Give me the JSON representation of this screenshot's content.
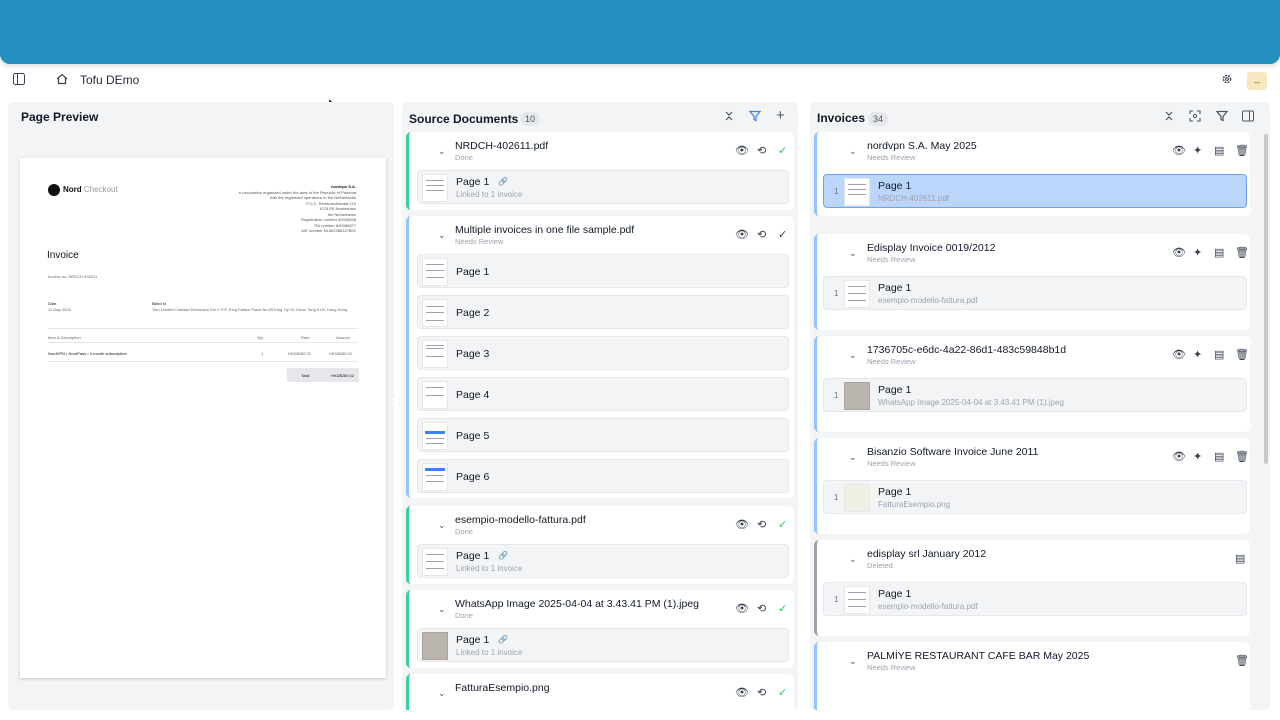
{
  "app": {
    "title": "Tofu DEmo",
    "avatar_text": "_"
  },
  "icons": {
    "sidebar_toggle": "sidebar-toggle-icon",
    "home": "home-icon",
    "settings": "gear-icon",
    "collapse": "collapse-icon",
    "filter": "filter-icon",
    "add": "plus-icon",
    "focus": "focus-icon",
    "split": "split-view-icon",
    "view": "eye-icon",
    "reprocess": "reprocess-icon",
    "check": "check-icon",
    "ai": "sparkle-icon",
    "details": "document-icon",
    "delete": "trash-icon",
    "link": "link-icon",
    "chevron": "chevron-down-icon"
  },
  "colors": {
    "banner": "#2490bf",
    "done_border": "#34d399",
    "review_border": "#93c5fd",
    "deleted_border": "#9ca3af",
    "selected_row": "#bcd6fb"
  },
  "preview": {
    "title": "Page Preview",
    "doc": {
      "brand": "Nord",
      "brand_suffix": "Checkout",
      "company_name": "nordvpn S.A.",
      "company_lines": [
        "a corporation organized under the laws of the Republic of Panama",
        "with the registered operations in the Netherlands",
        "P.O.C. Rembrandtstraat 110",
        "1078 EE Amsterdam",
        "the Netherlands",
        "Registration number 80045098",
        "TIN number 860086877",
        "VAT number NL861986147B01"
      ],
      "title": "Invoice",
      "invoice_no": "Invoice no. NRDCH-402611",
      "date_label": "Date",
      "date_value": "11 May 2025",
      "billed_label": "Billed to",
      "billed_value": "Tofu Limited Christaa Reinmann Km.C F/F, King Palace Plaza No.55 King Yip St, Kwun Tong KLN, Hong Kong",
      "col_item": "Item & Description",
      "col_qty": "Qty",
      "col_rate": "Rate",
      "col_amount": "Amount",
      "item": "NordVPN • NordPass • 1-month subscription",
      "qty": "1",
      "rate": "HKD$280.02",
      "amount": "HKD$280.02",
      "total_label": "Total",
      "total_value": "HKD$280.02"
    }
  },
  "source": {
    "title": "Source Documents",
    "count": "10",
    "docs": [
      {
        "name": "NRDCH-402611.pdf",
        "status": "Done",
        "pages": [
          {
            "label": "Page 1",
            "sub": "Linked to 1 invoice"
          }
        ]
      },
      {
        "name": "Multiple invoices in one file sample.pdf",
        "status": "Needs Review",
        "pages": [
          {
            "label": "Page 1"
          },
          {
            "label": "Page 2"
          },
          {
            "label": "Page 3"
          },
          {
            "label": "Page 4"
          },
          {
            "label": "Page 5"
          },
          {
            "label": "Page 6"
          }
        ]
      },
      {
        "name": "esempio-modello-fattura.pdf",
        "status": "Done",
        "pages": [
          {
            "label": "Page 1",
            "sub": "Linked to 1 invoice"
          }
        ]
      },
      {
        "name": "WhatsApp Image 2025-04-04 at 3.43.41 PM (1).jpeg",
        "status": "Done",
        "pages": [
          {
            "label": "Page 1",
            "sub": "Linked to 1 invoice"
          }
        ]
      },
      {
        "name": "FatturaEsempio.png",
        "status": "",
        "pages": []
      }
    ]
  },
  "invoices": {
    "title": "Invoices",
    "count": "34",
    "items": [
      {
        "name": "nordvpn S.A. May 2025",
        "status": "Needs Review",
        "num": "1",
        "page": "Page 1",
        "file": "NRDCH-402611.pdf"
      },
      {
        "name": "Edisplay Invoice 0019/2012",
        "status": "Needs Review",
        "num": "1",
        "page": "Page 1",
        "file": "esempio-modello-fattura.pdf"
      },
      {
        "name": "1736705c-e6dc-4a22-86d1-483c59848b1d",
        "status": "Needs Review",
        "num": "1",
        "page": "Page 1",
        "file": "WhatsApp Image 2025-04-04 at 3.43.41 PM (1).jpeg"
      },
      {
        "name": "Bisanzio Software Invoice June 2011",
        "status": "Needs Review",
        "num": "1",
        "page": "Page 1",
        "file": "FatturaEsempio.png"
      },
      {
        "name": "edisplay srl January 2012",
        "status": "Deleted",
        "num": "1",
        "page": "Page 1",
        "file": "esempio-modello-fattura.pdf"
      },
      {
        "name": "PALMİYE RESTAURANT CAFE BAR May 2025",
        "status": "Needs Review"
      }
    ]
  }
}
